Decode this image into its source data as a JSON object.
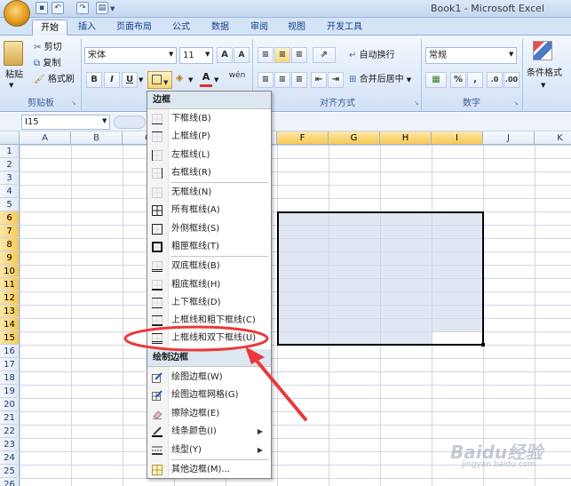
{
  "window": {
    "title": "Book1 - Microsoft Excel"
  },
  "quick_access": [
    "save-icon",
    "undo-icon",
    "redo-icon",
    "print-icon"
  ],
  "tabs": [
    "开始",
    "插入",
    "页面布局",
    "公式",
    "数据",
    "审阅",
    "视图",
    "开发工具"
  ],
  "active_tab": "开始",
  "clipboard": {
    "paste": "粘贴",
    "cut": "剪切",
    "copy": "复制",
    "format_painter": "格式刷",
    "group": "剪贴板"
  },
  "font": {
    "name": "宋体",
    "size": "11",
    "bold": "B",
    "italic": "I",
    "underline": "U",
    "grow": "A",
    "shrink": "A",
    "font_color_letter": "A",
    "phonetic": "wén"
  },
  "alignment": {
    "wrap_text": "自动换行",
    "merge_center": "合并后居中",
    "group": "对齐方式"
  },
  "number": {
    "format": "常规",
    "percent": "%",
    "comma": ",",
    "group": "数字"
  },
  "styles": {
    "conditional_format": "条件格式"
  },
  "formula_bar": {
    "name_box": "I15",
    "fx": "fx",
    "content": ""
  },
  "columns": [
    "A",
    "B",
    "C",
    "D",
    "E",
    "F",
    "G",
    "H",
    "I",
    "J",
    "K"
  ],
  "rows": [
    "1",
    "2",
    "3",
    "4",
    "5",
    "6",
    "7",
    "8",
    "9",
    "10",
    "11",
    "12",
    "13",
    "14",
    "15",
    "16",
    "17",
    "18",
    "19",
    "20",
    "21",
    "22",
    "23",
    "24",
    "25",
    "26",
    "27"
  ],
  "selected_columns": [
    "F",
    "G",
    "H",
    "I"
  ],
  "selected_rows": [
    "6",
    "7",
    "8",
    "9",
    "10",
    "11",
    "12",
    "13",
    "14",
    "15"
  ],
  "border_menu": {
    "header": "边框",
    "items": [
      {
        "label": "下框线(B)",
        "icon": "bottom-border-icon"
      },
      {
        "label": "上框线(P)",
        "icon": "top-border-icon"
      },
      {
        "label": "左框线(L)",
        "icon": "left-border-icon"
      },
      {
        "label": "右框线(R)",
        "icon": "right-border-icon"
      },
      {
        "label": "无框线(N)",
        "icon": "no-border-icon"
      },
      {
        "label": "所有框线(A)",
        "icon": "all-borders-icon"
      },
      {
        "label": "外侧框线(S)",
        "icon": "outside-borders-icon"
      },
      {
        "label": "粗匣框线(T)",
        "icon": "thick-box-border-icon"
      },
      {
        "label": "双底框线(B)",
        "icon": "bottom-double-border-icon"
      },
      {
        "label": "粗底框线(H)",
        "icon": "thick-bottom-border-icon"
      },
      {
        "label": "上下框线(D)",
        "icon": "top-bottom-border-icon"
      },
      {
        "label": "上框线和粗下框线(C)",
        "icon": "top-thick-bottom-border-icon"
      },
      {
        "label": "上框线和双下框线(U)",
        "icon": "top-double-bottom-border-icon"
      }
    ],
    "draw_header": "绘制边框",
    "draw_items": [
      {
        "label": "绘图边框(W)",
        "icon": "draw-border-icon"
      },
      {
        "label": "绘图边框网格(G)",
        "icon": "draw-border-grid-icon"
      },
      {
        "label": "擦除边框(E)",
        "icon": "eraser-icon"
      },
      {
        "label": "线条颜色(I)",
        "icon": "line-color-icon",
        "submenu": true
      },
      {
        "label": "线型(Y)",
        "icon": "line-style-icon",
        "submenu": true
      },
      {
        "label": "其他边框(M)...",
        "icon": "more-borders-icon"
      }
    ]
  },
  "annotation": {
    "color": "#e8393b"
  },
  "watermark": {
    "text": "Baidu经验",
    "subtext": "jingyan.baidu.com"
  },
  "colors": {
    "accent": "#15428b",
    "selection_fill": "#e1e6f3",
    "header_selected": "#f8c953"
  }
}
